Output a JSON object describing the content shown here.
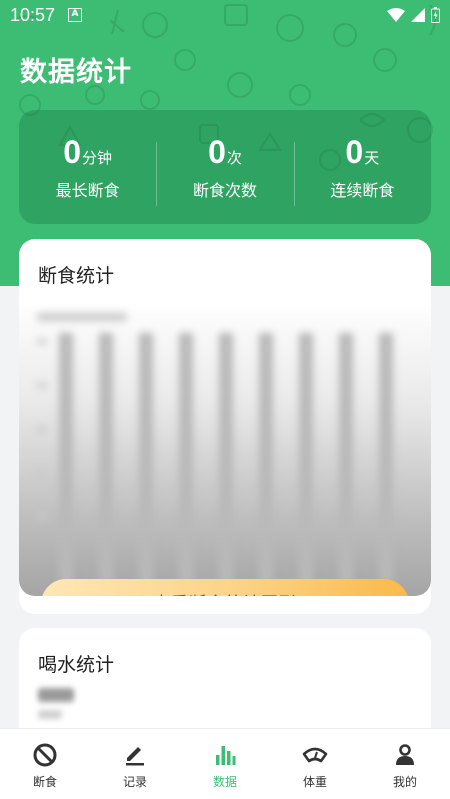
{
  "status_bar": {
    "time": "10:57",
    "notification_letter": "A"
  },
  "page_title": "数据统计",
  "summary": [
    {
      "value": "0",
      "unit": "分钟",
      "label": "最长断食"
    },
    {
      "value": "0",
      "unit": "次",
      "label": "断食次数"
    },
    {
      "value": "0",
      "unit": "天",
      "label": "连续断食"
    }
  ],
  "fasting_card": {
    "title": "断食统计",
    "view_button": "查看断食统计图形"
  },
  "water_card": {
    "title": "喝水统计"
  },
  "bottom_nav": [
    {
      "label": "断食",
      "icon": "no-symbol-icon"
    },
    {
      "label": "记录",
      "icon": "pencil-icon"
    },
    {
      "label": "数据",
      "icon": "bar-chart-icon",
      "active": true
    },
    {
      "label": "体重",
      "icon": "scale-icon"
    },
    {
      "label": "我的",
      "icon": "person-icon"
    }
  ],
  "colors": {
    "brand_green": "#3dbd73",
    "button_gradient_start": "#ffe7b4",
    "button_gradient_end": "#fbb94a",
    "button_text": "#8a5a10"
  }
}
